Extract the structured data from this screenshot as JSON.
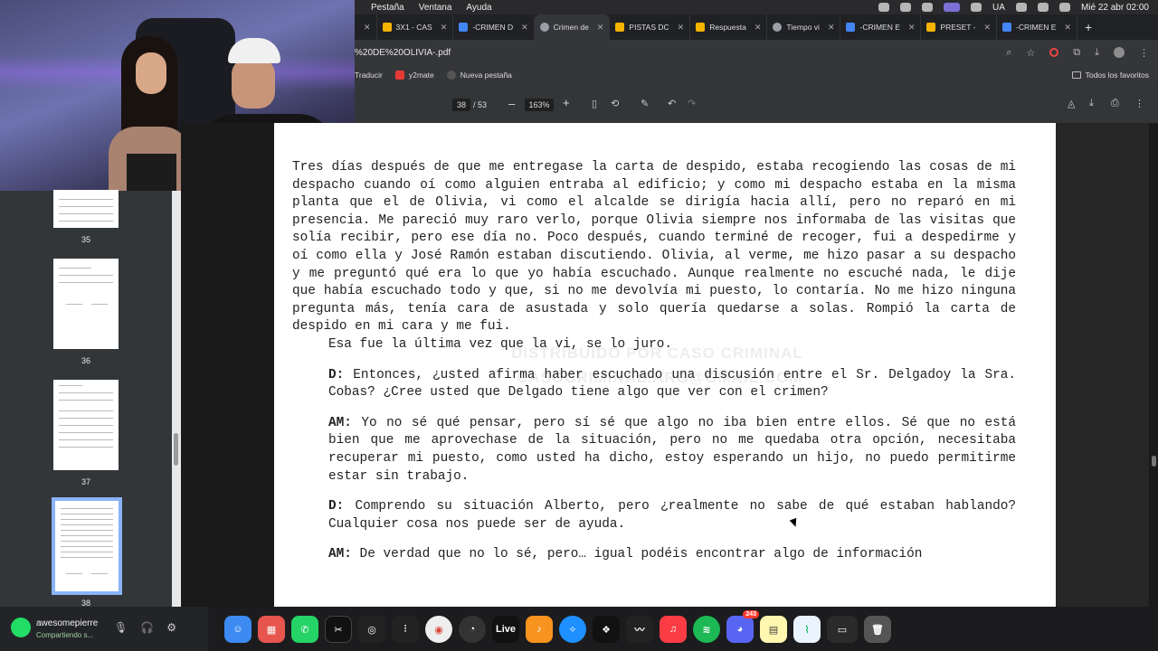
{
  "menubar": {
    "items": [
      "Pestaña",
      "Ventana",
      "Ayuda"
    ],
    "lang": "UA",
    "datetime": "Mié 22 abr  02:00"
  },
  "tabs": [
    {
      "label": "3X1 - CAS",
      "color": "#f4b400",
      "active": false
    },
    {
      "label": "-CRIMEN D",
      "color": "#4285f4",
      "active": false
    },
    {
      "label": "Crimen de",
      "color": "#9aa0a6",
      "active": true
    },
    {
      "label": "PISTAS DC",
      "color": "#f4b400",
      "active": false
    },
    {
      "label": "Respuesta",
      "color": "#f4b400",
      "active": false
    },
    {
      "label": "Tiempo vi",
      "color": "#9aa0a6",
      "active": false
    },
    {
      "label": "-CRIMEN E",
      "color": "#4285f4",
      "active": false
    },
    {
      "label": "PRESET -",
      "color": "#f4b400",
      "active": false
    },
    {
      "label": "-CRIMEN E",
      "color": "#4285f4",
      "active": false
    }
  ],
  "address": {
    "url": "%20DE%20OLIVIA-.pdf"
  },
  "bookmarks": {
    "items": [
      "Traducir",
      "y2mate",
      "Nueva pestaña"
    ],
    "all_favorites": "Todos los favoritos"
  },
  "pdf": {
    "page_current": "38",
    "page_total": "/ 53",
    "zoom": "163%",
    "thumbnails": [
      {
        "num": "35"
      },
      {
        "num": "36"
      },
      {
        "num": "37"
      },
      {
        "num": "38"
      }
    ]
  },
  "document": {
    "watermark": "DISTRIBUIDO POR CASO CRIMINAL",
    "watermark_email": "CASOCRIMINAL.ARG@GMAIL.COM",
    "para1": "Tres días después de que me entregase la carta de despido, estaba recogiendo las cosas de mi despacho cuando oí como alguien entraba al edificio; y como mi despacho estaba en la misma planta que el de Olivia, vi como el alcalde se dirigía hacia allí, pero no reparó en mi presencia. Me pareció muy raro verlo, porque Olivia siempre nos informaba de las visitas que solía recibir, pero ese día no. Poco después, cuando terminé de recoger, fui a despedirme y oí como ella y José Ramón estaban discutiendo. Olivia, al verme, me hizo pasar a su despacho y me preguntó qué era lo que yo había escuchado. Aunque realmente no escuché nada, le dije que había escuchado todo y que, si no me devolvía mi puesto, lo contaría. No me hizo ninguna pregunta más, tenía cara de asustada y solo quería quedarse a solas. Rompió la carta de despido en mi cara y me fui.",
    "para1b": "Esa fue la última vez que la vi, se lo juro.",
    "q1_speaker": "D:",
    "q1": " Entonces, ¿usted afirma haber escuchado una discusión entre el Sr. Delgadoy la Sra. Cobas? ¿Cree usted que Delgado tiene algo que ver con el crimen?",
    "a1_speaker": "AM:",
    "a1": " Yo no sé qué pensar, pero sí sé que algo no iba bien entre ellos. Sé que no está bien que me aprovechase de la situación, pero no me quedaba otra opción, necesitaba recuperar mi puesto, como usted ha dicho, estoy esperando un hijo, no puedo permitirme estar sin trabajo.",
    "q2_speaker": "D:",
    "q2": " Comprendo su situación Alberto, pero ¿realmente no sabe de qué estaban hablando? Cualquier cosa nos puede ser de ayuda.",
    "a2_speaker": "AM:",
    "a2": " De verdad que no lo sé, pero… igual podéis encontrar algo de información"
  },
  "discord": {
    "username": "awesomepierre",
    "status": "Compartiendo s..."
  },
  "dock": {
    "live_label": "Live",
    "discord_badge": "243"
  }
}
